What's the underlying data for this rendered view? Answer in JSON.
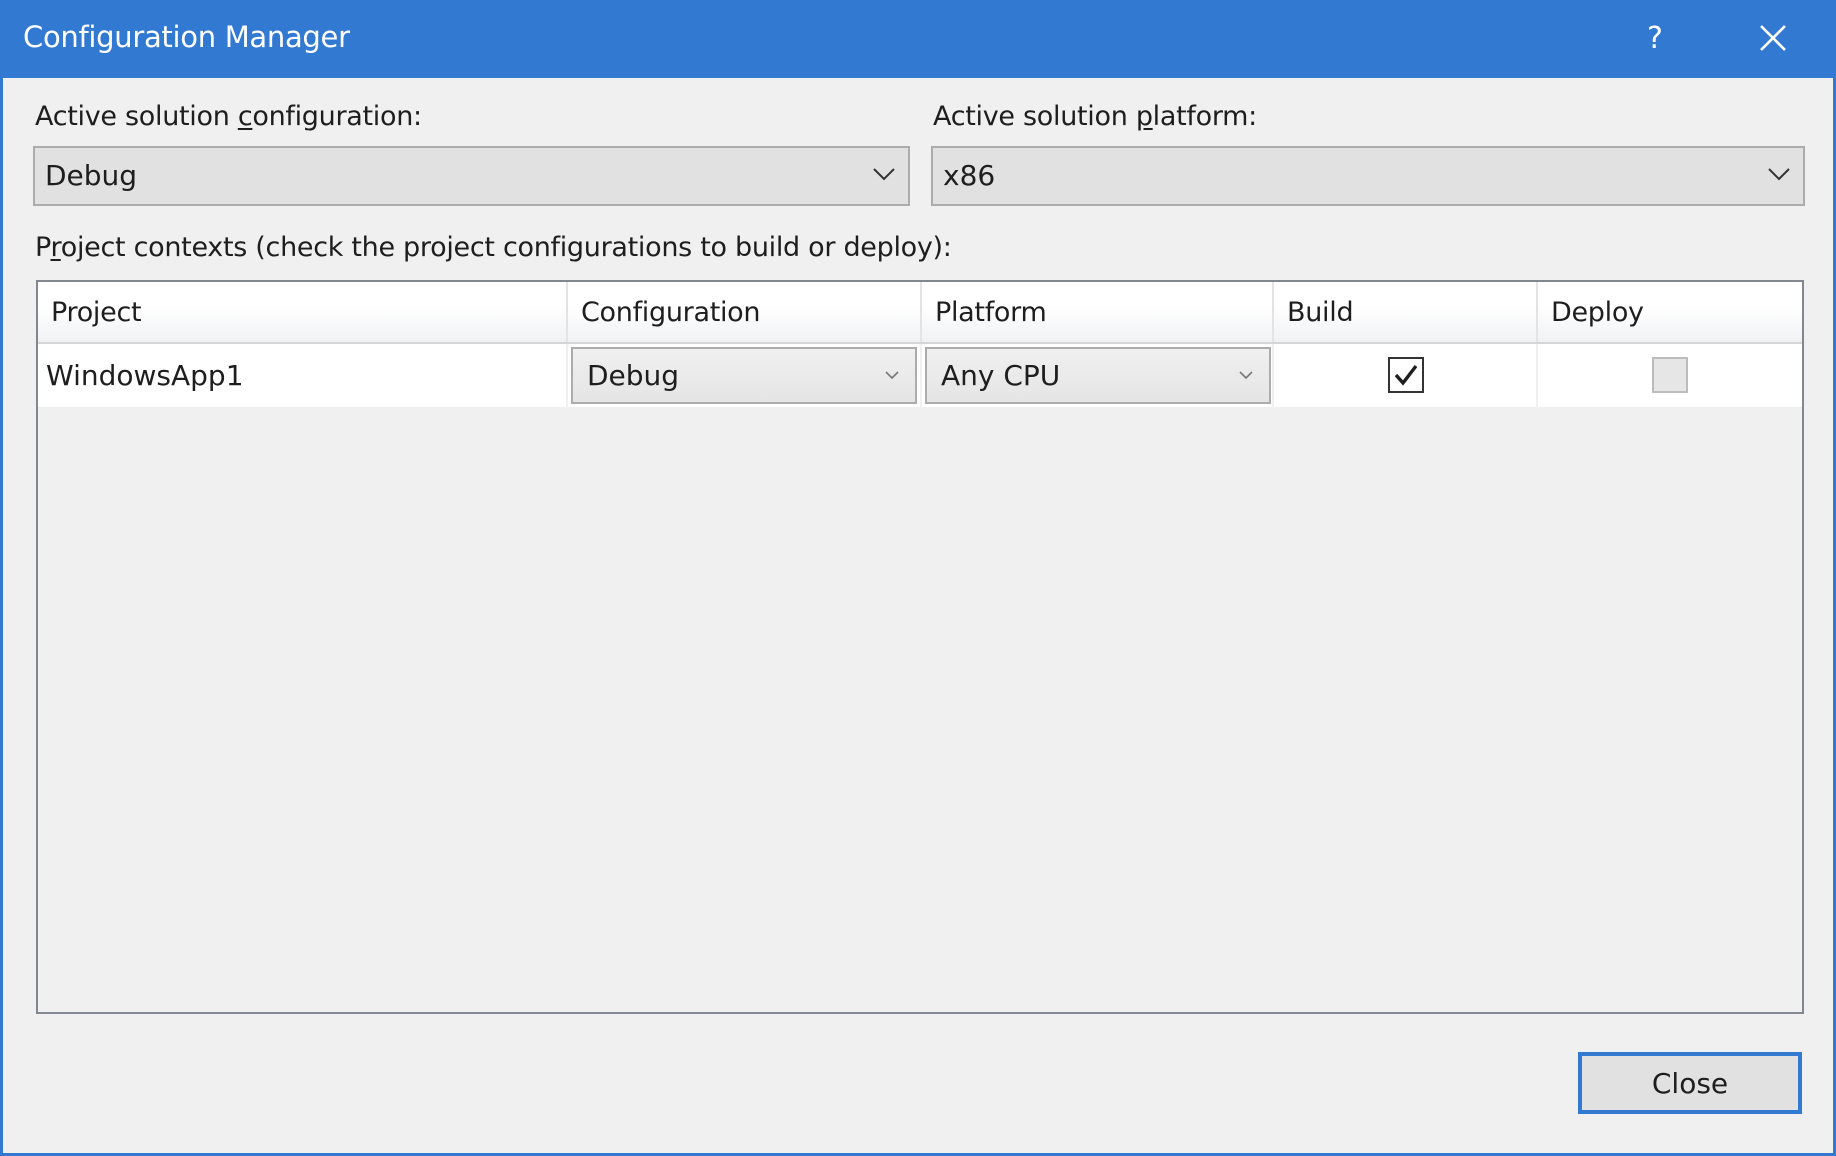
{
  "window": {
    "title": "Configuration Manager",
    "help_icon": "question-mark-icon",
    "help_glyph": "?",
    "close_icon": "close-x-icon",
    "accent_color": "#3279d1"
  },
  "active_configuration": {
    "label_before": "Active solution ",
    "label_mnemonic": "c",
    "label_after": "onfiguration:",
    "value": "Debug"
  },
  "active_platform": {
    "label_before": "Active solution ",
    "label_mnemonic": "p",
    "label_after": "latform:",
    "value": "x86"
  },
  "project_contexts": {
    "label_before": "P",
    "label_mnemonic": "r",
    "label_after": "oject contexts (check the project configurations to build or deploy):"
  },
  "grid": {
    "columns": [
      "Project",
      "Configuration",
      "Platform",
      "Build",
      "Deploy"
    ],
    "rows": [
      {
        "project": "WindowsApp1",
        "configuration": "Debug",
        "platform": "Any CPU",
        "build": true,
        "deploy": false,
        "deploy_enabled": false
      }
    ]
  },
  "footer": {
    "close_label": "Close"
  }
}
